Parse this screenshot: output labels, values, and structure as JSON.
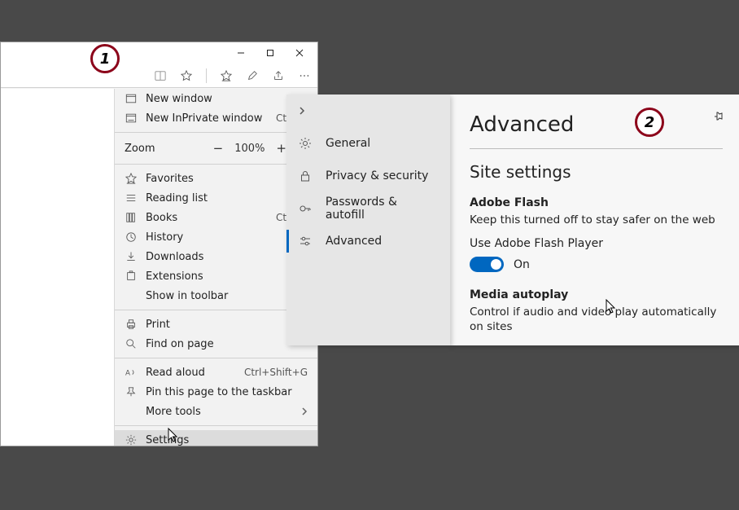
{
  "callouts": {
    "one": "1",
    "two": "2"
  },
  "menu": {
    "new_window": "New window",
    "new_inprivate": "New InPrivate window",
    "new_inprivate_kbd": "Ctrl+S",
    "zoom_label": "Zoom",
    "zoom_value": "100%",
    "favorites": "Favorites",
    "reading_list": "Reading list",
    "books": "Books",
    "books_kbd": "Ctrl+S",
    "history": "History",
    "downloads": "Downloads",
    "extensions": "Extensions",
    "show_in_toolbar": "Show in toolbar",
    "print": "Print",
    "find_on_page": "Find on page",
    "read_aloud": "Read aloud",
    "read_aloud_kbd": "Ctrl+Shift+G",
    "pin_taskbar": "Pin this page to the taskbar",
    "more_tools": "More tools",
    "settings": "Settings"
  },
  "settings_sidebar": {
    "general": "General",
    "privacy": "Privacy & security",
    "passwords": "Passwords & autofill",
    "advanced": "Advanced"
  },
  "advanced": {
    "title": "Advanced",
    "site_settings": "Site settings",
    "flash_label": "Adobe Flash",
    "flash_desc": "Keep this turned off to stay safer on the web",
    "flash_sub": "Use Adobe Flash Player",
    "flash_state": "On",
    "media_label": "Media autoplay",
    "media_desc": "Control if audio and video play automatically on sites"
  }
}
